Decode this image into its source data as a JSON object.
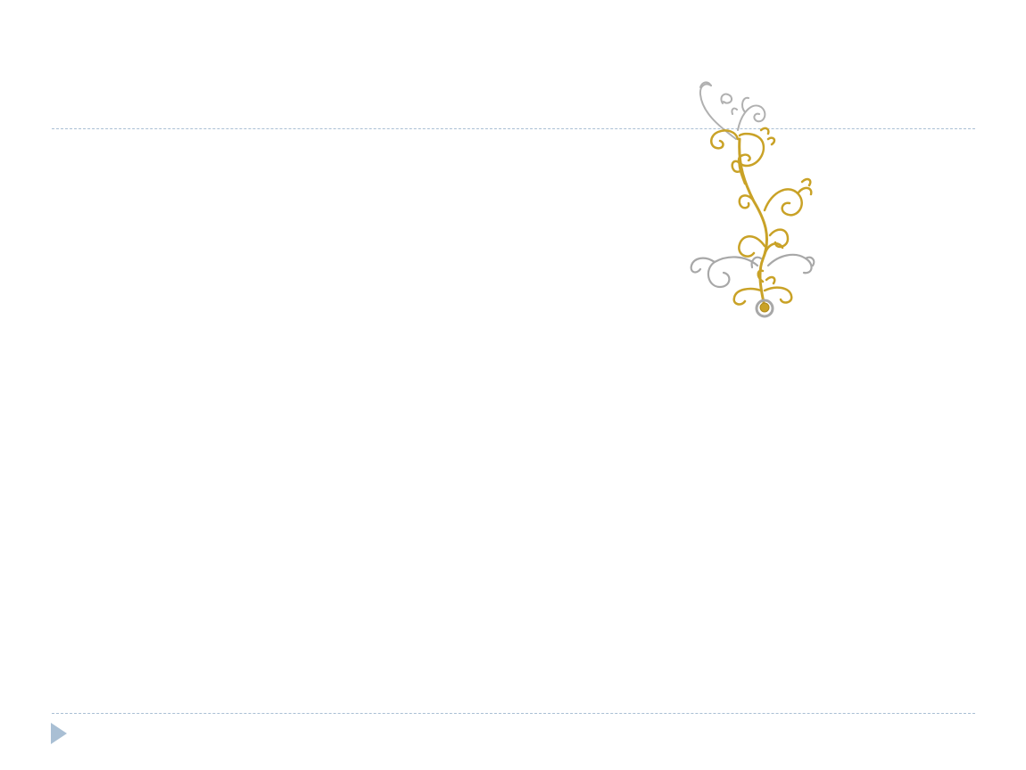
{
  "slide": {
    "title": "",
    "body": ""
  },
  "ornament": {
    "icon": "floral-swirl-ornament",
    "colors": {
      "gold": "#c9a227",
      "silver": "#a8a8a8"
    }
  },
  "navigation": {
    "icon": "triangle-right-icon",
    "color": "#a9bfd4"
  },
  "theme": {
    "rule_color": "#a9bfd4",
    "background": "#ffffff"
  }
}
